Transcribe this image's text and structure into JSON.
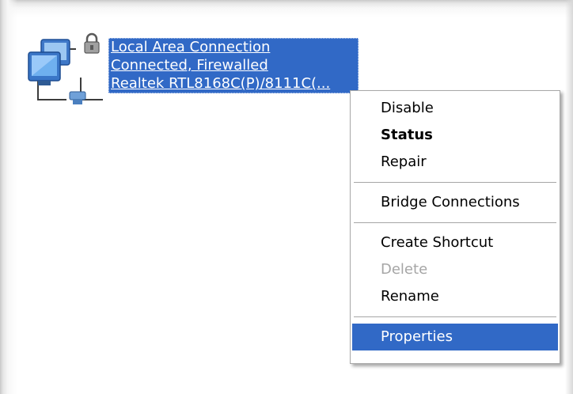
{
  "connection": {
    "name": "Local Area Connection",
    "status": "Connected, Firewalled",
    "device": "Realtek RTL8168C(P)/8111C(...",
    "icon": "network-connection-icon",
    "overlay_icon": "padlock-icon",
    "highlight_color": "#3169c6"
  },
  "context_menu": {
    "items": [
      {
        "label": "Disable",
        "state": "normal"
      },
      {
        "label": "Status",
        "state": "default"
      },
      {
        "label": "Repair",
        "state": "normal"
      },
      {
        "label": "Bridge Connections",
        "state": "normal"
      },
      {
        "label": "Create Shortcut",
        "state": "normal"
      },
      {
        "label": "Delete",
        "state": "disabled"
      },
      {
        "label": "Rename",
        "state": "normal"
      },
      {
        "label": "Properties",
        "state": "selected"
      }
    ]
  }
}
